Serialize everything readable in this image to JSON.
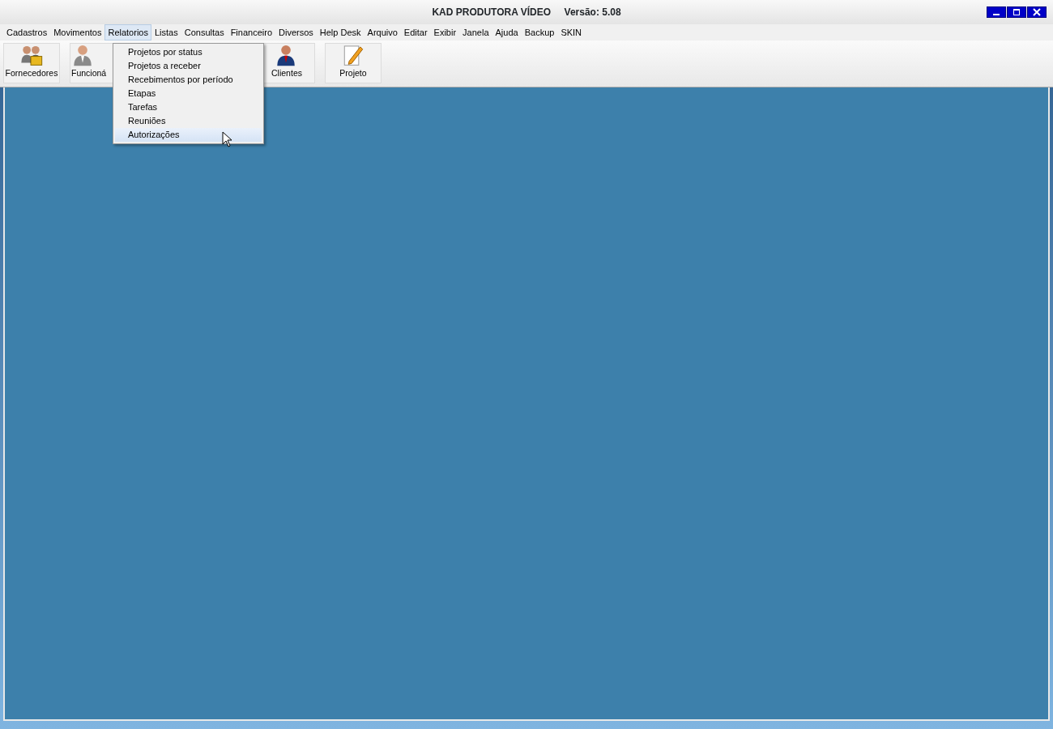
{
  "window": {
    "title": "KAD PRODUTORA VÍDEO",
    "version": "Versão: 5.08"
  },
  "menu_bar": [
    {
      "label": "Cadastros",
      "selected": false
    },
    {
      "label": "Movimentos",
      "selected": false
    },
    {
      "label": "Relatorios",
      "selected": true
    },
    {
      "label": "Listas",
      "selected": false
    },
    {
      "label": "Consultas",
      "selected": false
    },
    {
      "label": "Financeiro",
      "selected": false
    },
    {
      "label": "Diversos",
      "selected": false
    },
    {
      "label": "Help Desk",
      "selected": false
    },
    {
      "label": "Arquivo",
      "selected": false
    },
    {
      "label": "Editar",
      "selected": false
    },
    {
      "label": "Exibir",
      "selected": false
    },
    {
      "label": "Janela",
      "selected": false
    },
    {
      "label": "Ajuda",
      "selected": false
    },
    {
      "label": "Backup",
      "selected": false
    },
    {
      "label": "SKIN",
      "selected": false
    }
  ],
  "dropdown": [
    {
      "label": "Projetos por status",
      "selected": false
    },
    {
      "label": "Projetos a receber",
      "selected": false
    },
    {
      "label": "Recebimentos por período",
      "selected": false
    },
    {
      "label": "Etapas",
      "selected": false
    },
    {
      "label": "Tarefas",
      "selected": false
    },
    {
      "label": "Reuniões",
      "selected": false
    },
    {
      "label": "Autorizações",
      "selected": true
    }
  ],
  "toolbar": [
    {
      "label": "Fornecedores",
      "kind": "group"
    },
    {
      "label": "Funcioná",
      "kind": "person"
    },
    {
      "label": "Clientes",
      "kind": "client"
    },
    {
      "label": "Projeto",
      "kind": "pencil"
    }
  ]
}
